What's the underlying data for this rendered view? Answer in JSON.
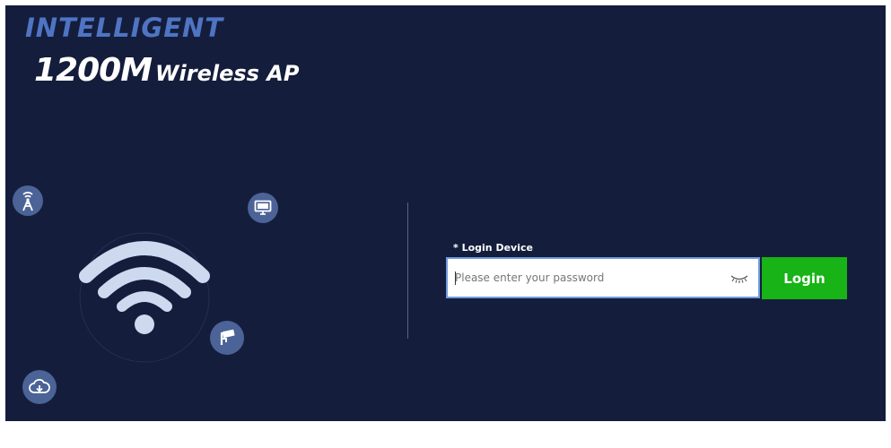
{
  "brand": {
    "line1": "INTELLIGENT",
    "model_big": "1200M",
    "model_small": "Wireless AP"
  },
  "login": {
    "label": "* Login Device",
    "password_placeholder": "Please enter your password",
    "password_value": "",
    "button_label": "Login"
  },
  "icons": {
    "tower": "antenna-tower-icon",
    "monitor": "monitor-icon",
    "camera": "security-camera-icon",
    "cloud": "cloud-download-icon",
    "eye": "eye-closed-icon",
    "wifi": "wifi-icon"
  },
  "colors": {
    "background": "#141d3b",
    "brand_blue": "#4f74c4",
    "icon_circle": "#4b6396",
    "login_green": "#17b317",
    "input_border": "#6f9be0"
  }
}
